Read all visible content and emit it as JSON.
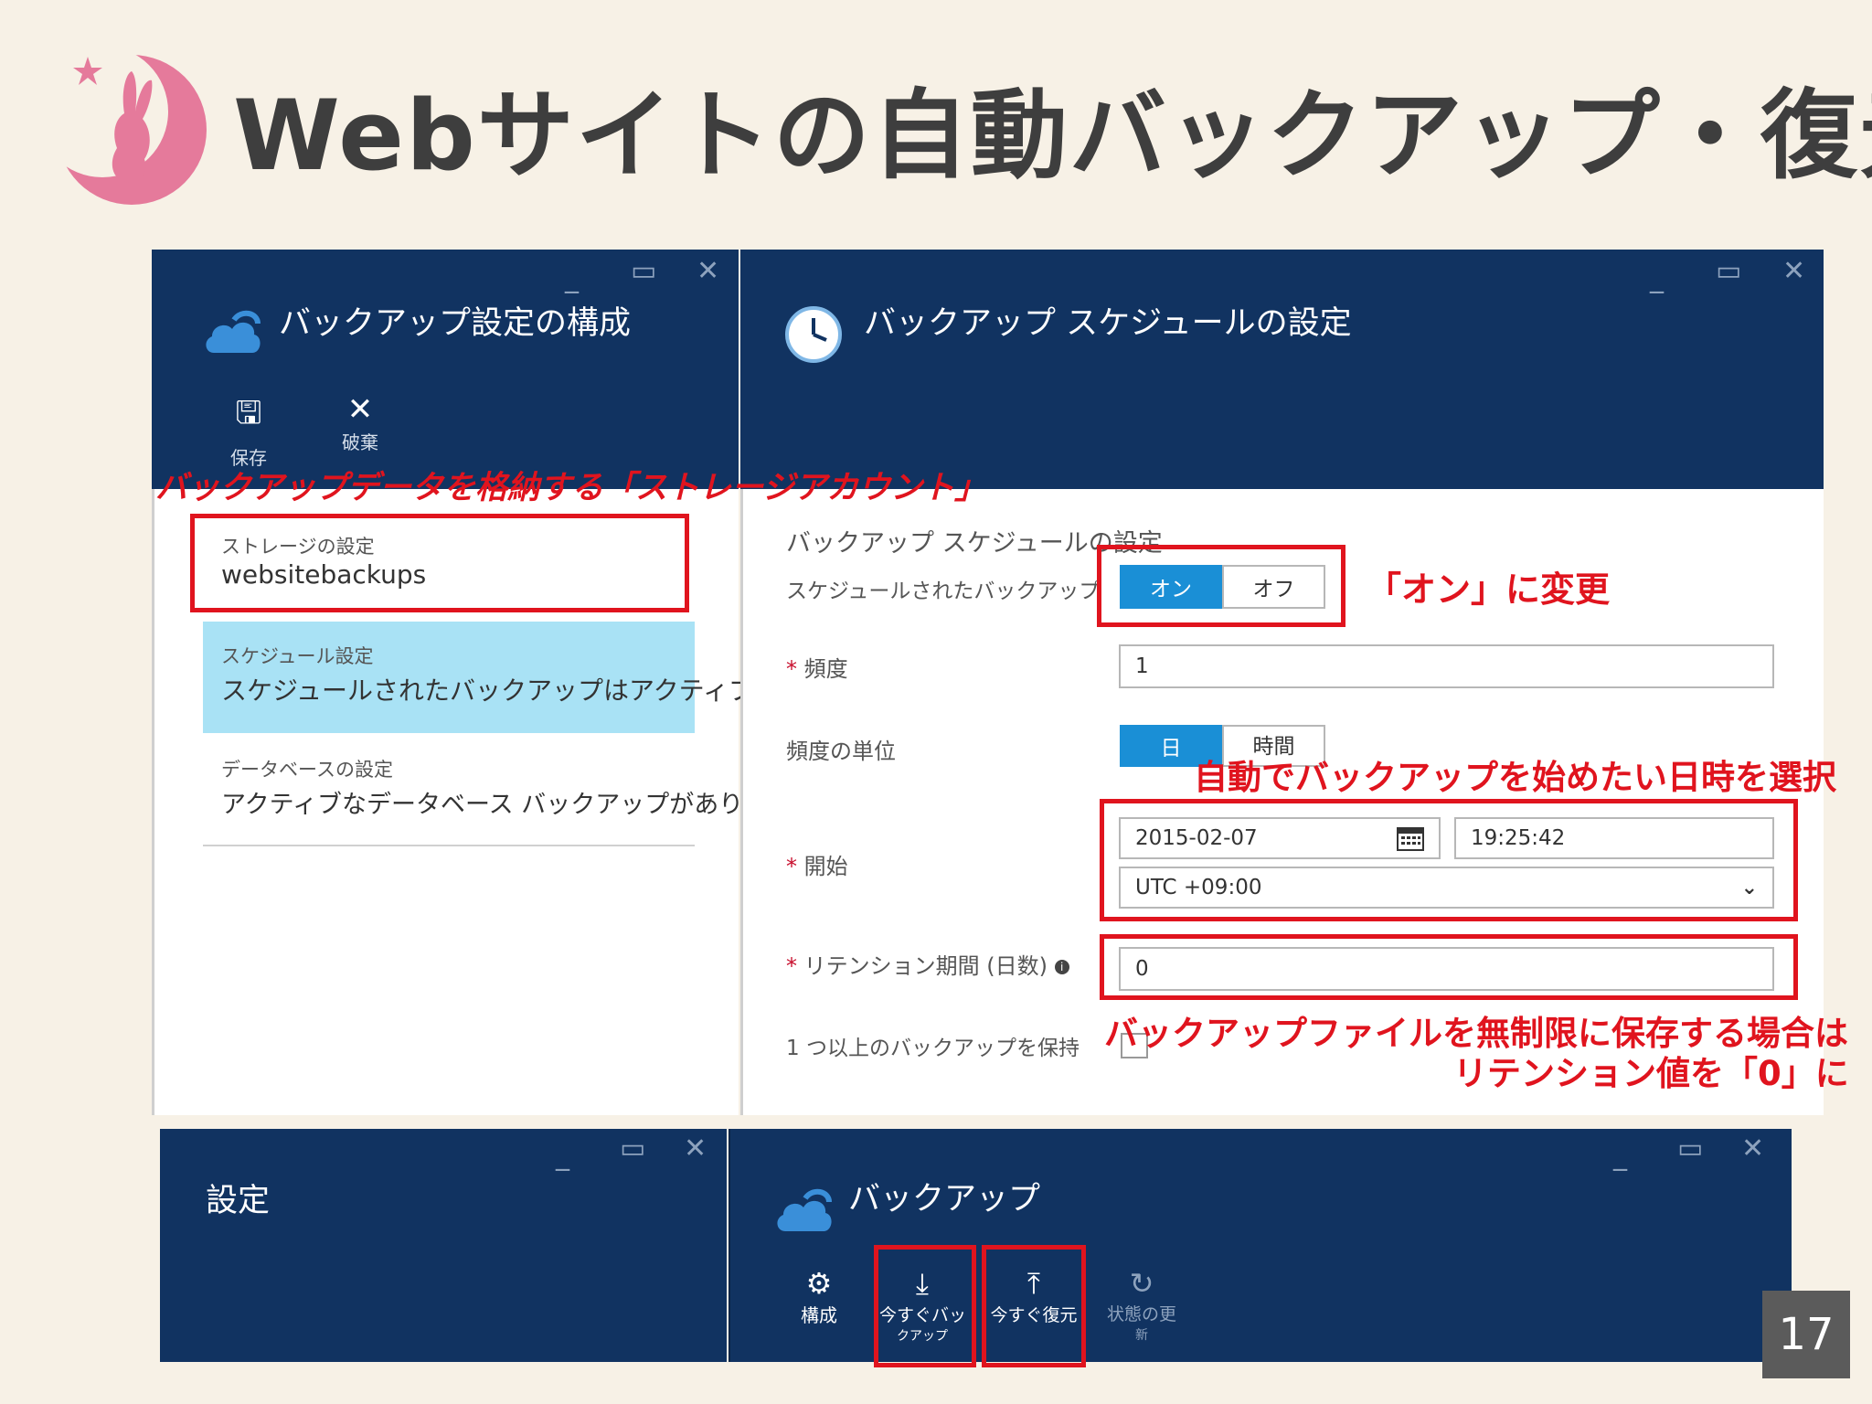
{
  "slide": {
    "title": "Webサイトの自動バックアップ・復元",
    "page_number": "17"
  },
  "blade_backup_config": {
    "title": "バックアップ設定の構成",
    "toolbar": {
      "save_label": "保存",
      "discard_label": "破棄"
    },
    "items": [
      {
        "label": "ストレージの設定",
        "value": "websitebackups"
      },
      {
        "label": "スケジュール設定",
        "value": "スケジュールされたバックアップはアクティブです"
      },
      {
        "label": "データベースの設定",
        "value": "アクティブなデータベース バックアップがありません"
      }
    ]
  },
  "blade_schedule": {
    "title": "バックアップ スケジュールの設定",
    "section_heading": "バックアップ スケジュールの設定",
    "scheduled_backup": {
      "label": "スケジュールされたバックアップ",
      "on": "オン",
      "off": "オフ",
      "selected": "オン"
    },
    "frequency": {
      "required": "*",
      "label": "頻度",
      "value": "1"
    },
    "frequency_unit": {
      "label": "頻度の単位",
      "day": "日",
      "hour": "時間",
      "selected": "日"
    },
    "start": {
      "required": "*",
      "label": "開始",
      "date": "2015-02-07",
      "time": "19:25:42",
      "timezone": "UTC +09:00"
    },
    "retention": {
      "required": "*",
      "label": "リテンション期間 (日数)",
      "value": "0"
    },
    "keep_one": {
      "label": "1 つ以上のバックアップを保持"
    }
  },
  "blade_settings": {
    "title": "設定"
  },
  "blade_backup": {
    "title": "バックアップ",
    "toolbar": [
      {
        "label": "構成"
      },
      {
        "label_line1": "今すぐバッ",
        "label_line2": "クアップ"
      },
      {
        "label": "今すぐ復元"
      },
      {
        "label_line1": "状態の更",
        "label_line2": "新"
      }
    ]
  },
  "annotations": {
    "storage": "バックアップデータを格納する「ストレージアカウント」",
    "switch_on": "「オン」に変更",
    "start_time": "自動でバックアップを始めたい日時を選択",
    "retention_line1": "バックアップファイルを無制限に保存する場合は",
    "retention_line2": "リテンション値を「0」に"
  },
  "colors": {
    "navy": "#113361",
    "accent_blue": "#1a8fd6",
    "annotation_red": "#e0141e",
    "selected_item": "#a9e2f5",
    "logo_pink": "#e57a9b"
  }
}
